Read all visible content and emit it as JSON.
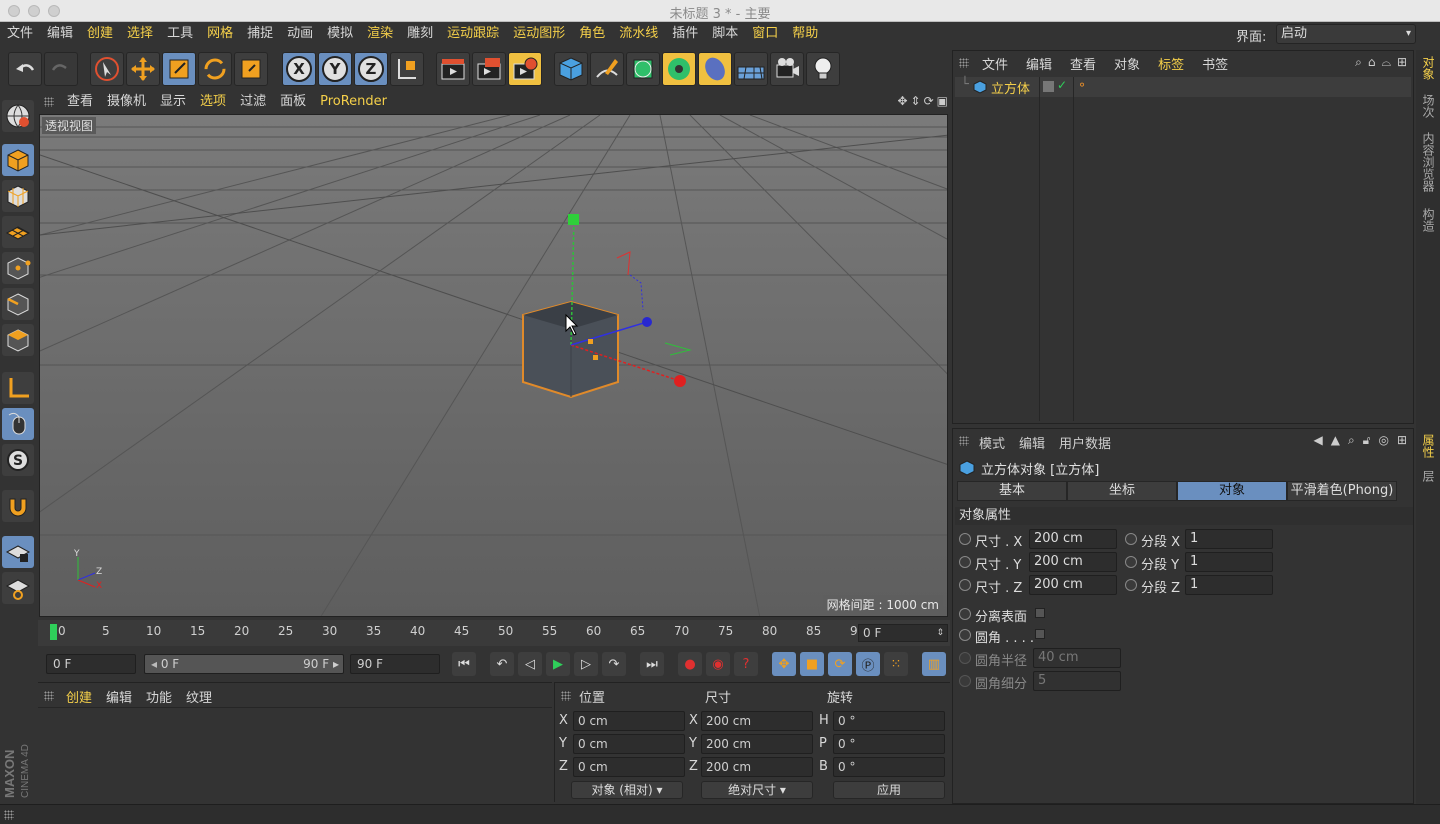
{
  "window": {
    "title": "未标题 3 * - 主要"
  },
  "menubar": {
    "items": [
      {
        "label": "文件",
        "hl": false
      },
      {
        "label": "编辑",
        "hl": false
      },
      {
        "label": "创建",
        "hl": true
      },
      {
        "label": "选择",
        "hl": true
      },
      {
        "label": "工具",
        "hl": false
      },
      {
        "label": "网格",
        "hl": true
      },
      {
        "label": "捕捉",
        "hl": false
      },
      {
        "label": "动画",
        "hl": false
      },
      {
        "label": "模拟",
        "hl": false
      },
      {
        "label": "渲染",
        "hl": true
      },
      {
        "label": "雕刻",
        "hl": false
      },
      {
        "label": "运动跟踪",
        "hl": true
      },
      {
        "label": "运动图形",
        "hl": true
      },
      {
        "label": "角色",
        "hl": true
      },
      {
        "label": "流水线",
        "hl": true
      },
      {
        "label": "插件",
        "hl": false
      },
      {
        "label": "脚本",
        "hl": false
      },
      {
        "label": "窗口",
        "hl": true
      },
      {
        "label": "帮助",
        "hl": true
      }
    ],
    "interface_label": "界面:",
    "interface_value": "启动"
  },
  "toolbar": {
    "axis_x": "X",
    "axis_y": "Y",
    "axis_z": "Z"
  },
  "viewport": {
    "menu": [
      {
        "label": "查看",
        "hl": false
      },
      {
        "label": "摄像机",
        "hl": false
      },
      {
        "label": "显示",
        "hl": false
      },
      {
        "label": "选项",
        "hl": true
      },
      {
        "label": "过滤",
        "hl": false
      },
      {
        "label": "面板",
        "hl": false
      },
      {
        "label": "ProRender",
        "hl": true
      }
    ],
    "view_name": "透视视图",
    "grid_spacing": "网格间距 : 1000 cm",
    "axis_labels": {
      "y": "Y",
      "z": "Z",
      "x": "X"
    }
  },
  "timeline": {
    "ticks": [
      "0",
      "5",
      "10",
      "15",
      "20",
      "25",
      "30",
      "35",
      "40",
      "45",
      "50",
      "55",
      "60",
      "65",
      "70",
      "75",
      "80",
      "85",
      "90"
    ],
    "current_frame": "0 F"
  },
  "transport": {
    "start_field": "0 F",
    "range_start": "0 F",
    "range_end": "90 F",
    "end_field": "90 F"
  },
  "material_panel": {
    "menu": [
      "创建",
      "编辑",
      "功能",
      "纹理"
    ]
  },
  "coord_panel": {
    "headers": {
      "position": "位置",
      "size": "尺寸",
      "rotation": "旋转"
    },
    "rows": [
      {
        "pl": "X",
        "pv": "0 cm",
        "sl": "X",
        "sv": "200 cm",
        "rl": "H",
        "rv": "0 °"
      },
      {
        "pl": "Y",
        "pv": "0 cm",
        "sl": "Y",
        "sv": "200 cm",
        "rl": "P",
        "rv": "0 °"
      },
      {
        "pl": "Z",
        "pv": "0 cm",
        "sl": "Z",
        "sv": "200 cm",
        "rl": "B",
        "rv": "0 °"
      }
    ],
    "mode_select": "对象 (相对)",
    "size_select": "绝对尺寸",
    "apply_label": "应用"
  },
  "object_manager": {
    "menu": [
      {
        "label": "文件",
        "hl": false
      },
      {
        "label": "编辑",
        "hl": false
      },
      {
        "label": "查看",
        "hl": false
      },
      {
        "label": "对象",
        "hl": false
      },
      {
        "label": "标签",
        "hl": true
      },
      {
        "label": "书签",
        "hl": false
      }
    ],
    "object_name": "立方体"
  },
  "attributes": {
    "menu": [
      "模式",
      "编辑",
      "用户数据"
    ],
    "title": "立方体对象 [立方体]",
    "tabs": [
      {
        "label": "基本",
        "sel": false
      },
      {
        "label": "坐标",
        "sel": false
      },
      {
        "label": "对象",
        "sel": true
      },
      {
        "label": "平滑着色(Phong)",
        "sel": false
      }
    ],
    "section": "对象属性",
    "size_x_label": "尺寸 . X",
    "size_x": "200 cm",
    "size_y_label": "尺寸 . Y",
    "size_y": "200 cm",
    "size_z_label": "尺寸 . Z",
    "size_z": "200 cm",
    "seg_x_label": "分段 X",
    "seg_x": "1",
    "seg_y_label": "分段 Y",
    "seg_y": "1",
    "seg_z_label": "分段 Z",
    "seg_z": "1",
    "separate_label": "分离表面",
    "fillet_label": "圆角 . . . .",
    "fillet_radius_label": "圆角半径",
    "fillet_radius": "40 cm",
    "fillet_sub_label": "圆角细分",
    "fillet_sub": "5"
  },
  "right_tabs": [
    {
      "label": "对象",
      "hl": true
    },
    {
      "label": "场次",
      "hl": false
    },
    {
      "label": "内容浏览器",
      "hl": false
    },
    {
      "label": "构造",
      "hl": false
    },
    {
      "label": "属性",
      "hl": true
    },
    {
      "label": "层",
      "hl": false
    }
  ],
  "brand": {
    "logo_text": "MAXON CINEMA 4D"
  },
  "colors": {
    "accent": "#f5d04a",
    "selected": "#6a8fbf",
    "object_outline": "#e08a2a"
  }
}
